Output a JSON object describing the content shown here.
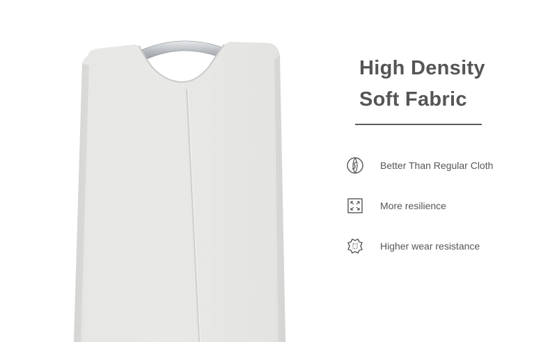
{
  "heading": {
    "line1": "High Density",
    "line2": "Soft Fabric"
  },
  "features": [
    {
      "icon": "shield-globe-icon",
      "label": "Better Than Regular Cloth"
    },
    {
      "icon": "expand-arrows-icon",
      "label": "More resilience"
    },
    {
      "icon": "leather-hide-icon",
      "label": "Higher wear resistance"
    }
  ],
  "colors": {
    "text": "#555555",
    "fabric": "#e6e6e4",
    "handle": "#b0b4b8"
  }
}
